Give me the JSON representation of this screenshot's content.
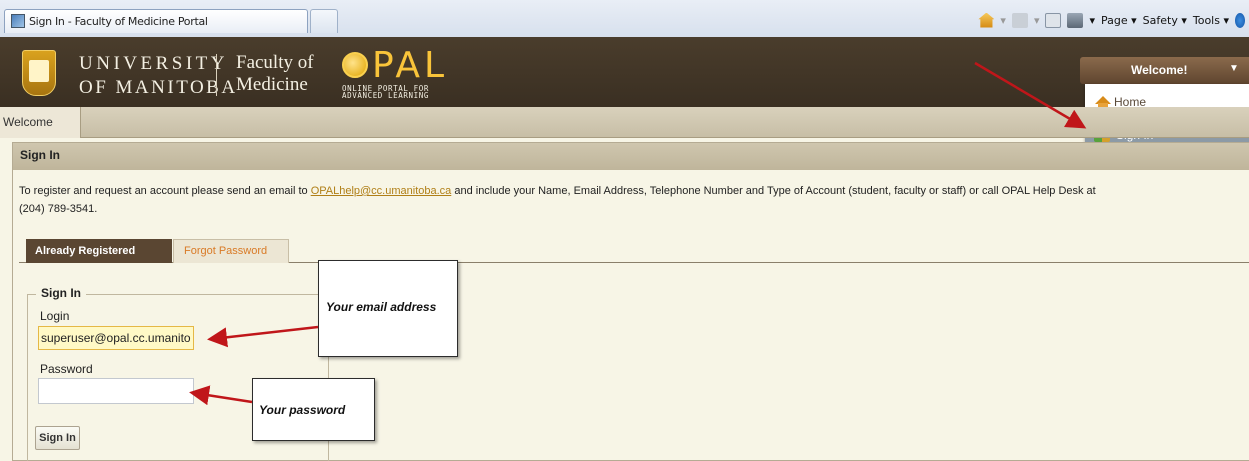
{
  "browser": {
    "tab_title": "Sign In - Faculty of Medicine Portal",
    "commands": {
      "page": "Page ▾",
      "safety": "Safety ▾",
      "tools": "Tools ▾"
    }
  },
  "header": {
    "university_line1": "UNIVERSITY",
    "university_line2": "OF MANITOBA",
    "faculty_line1": "Faculty of",
    "faculty_line2": "Medicine",
    "opal_word": "PAL",
    "opal_tag_line1": "ONLINE PORTAL FOR",
    "opal_tag_line2": "ADVANCED LEARNING"
  },
  "user_menu": {
    "button_label": "Welcome!",
    "items": [
      {
        "label": "Home",
        "icon": "home-icon"
      },
      {
        "label": "Sign In",
        "icon": "sign-in-icon",
        "active": true
      }
    ]
  },
  "nav": {
    "tab_label": "Welcome"
  },
  "panel": {
    "title": "Sign In",
    "info_prefix": "To register and request an account please send an email to ",
    "info_email": "OPALhelp@cc.umanitoba.ca",
    "info_suffix": " and include your Name, Email Address, Telephone Number and Type of Account (student, faculty or staff) or call OPAL Help Desk at",
    "info_line2": "(204) 789-3541."
  },
  "tabs": {
    "registered": "Already Registered",
    "forgot": "Forgot Password"
  },
  "form": {
    "legend": "Sign In",
    "login_label": "Login",
    "login_value": "superuser@opal.cc.umanito",
    "password_label": "Password",
    "password_value": "",
    "submit_label": "Sign In"
  },
  "annotations": {
    "email_callout": "Your email address",
    "password_callout": "Your password"
  },
  "colors": {
    "banner": "#3f3427",
    "accent_gold": "#f9c43a",
    "link": "#b07f17",
    "active_tab": "#5a4632",
    "arrow": "#c0161a"
  }
}
